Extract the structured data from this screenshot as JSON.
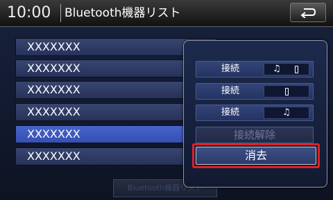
{
  "header": {
    "clock": "10:00",
    "title": "Bluetooth機器リスト",
    "back_icon": "return-arrow-icon"
  },
  "devices": [
    {
      "name": "XXXXXXX"
    },
    {
      "name": "XXXXXXX"
    },
    {
      "name": "XXXXXXX"
    },
    {
      "name": "XXXXXXX"
    },
    {
      "name": "XXXXXXX",
      "selected": true
    },
    {
      "name": "XXXXXXX"
    }
  ],
  "bottom_button": {
    "label": "Bluetooth機器リスト"
  },
  "popup": {
    "connect_both": {
      "label": "接続",
      "icons": [
        "music-note-icon",
        "phone-icon"
      ]
    },
    "connect_phone": {
      "label": "接続",
      "icons": [
        "phone-icon"
      ]
    },
    "connect_audio": {
      "label": "接続",
      "icons": [
        "music-note-icon"
      ]
    },
    "disconnect": {
      "label": "接続解除",
      "enabled": false
    },
    "erase": {
      "label": "消去",
      "highlighted": true
    }
  },
  "colors": {
    "highlight": "#e0202a",
    "selected_row": "#4864c8",
    "row": "#33416a"
  }
}
